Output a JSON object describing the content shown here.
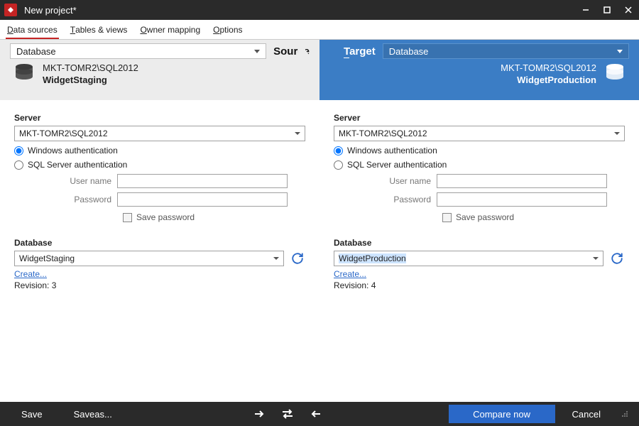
{
  "window": {
    "title": "New project*"
  },
  "menu": {
    "data_sources": "Data sources",
    "tables_views": "Tables & views",
    "owner_mapping": "Owner mapping",
    "options": "Options"
  },
  "srctgt": {
    "source_label": "Source",
    "target_label": "Target",
    "source_dropdown": "Database",
    "target_dropdown": "Database",
    "source_server": "MKT-TOMR2\\SQL2012",
    "source_db": "WidgetStaging",
    "target_server": "MKT-TOMR2\\SQL2012",
    "target_db": "WidgetProduction"
  },
  "labels": {
    "server": "Server",
    "win_auth": "Windows authentication",
    "sql_auth": "SQL Server authentication",
    "user_name": "User name",
    "password": "Password",
    "save_password": "Save password",
    "database": "Database",
    "create": "Create...",
    "revision_prefix": "Revision: "
  },
  "source": {
    "server": "MKT-TOMR2\\SQL2012",
    "auth": "windows",
    "username": "",
    "password": "",
    "save_password": false,
    "database": "WidgetStaging",
    "revision": "3"
  },
  "target": {
    "server": "MKT-TOMR2\\SQL2012",
    "auth": "windows",
    "username": "",
    "password": "",
    "save_password": false,
    "database": "WidgetProduction",
    "revision": "4"
  },
  "footer": {
    "save": "Save",
    "save_as": "Save as...",
    "compare_now": "Compare now",
    "cancel": "Cancel"
  }
}
